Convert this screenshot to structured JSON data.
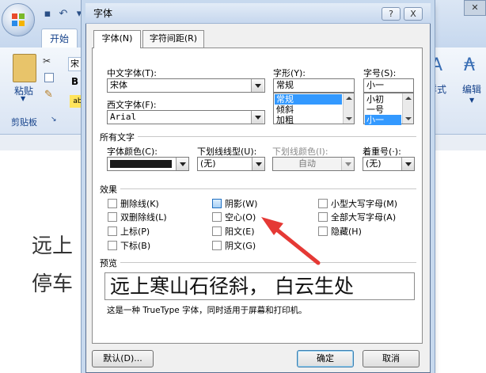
{
  "background": {
    "tab_start": "开始",
    "paste_label": "粘贴",
    "clipboard_label": "剪贴板",
    "font_box_value": "宋",
    "bold_glyph": "B",
    "ab_glyph": "ab",
    "styles_label": "样式",
    "editing_label": "编辑",
    "doc_line1": "远上",
    "doc_line2": "停车"
  },
  "dialog": {
    "title": "字体",
    "help_glyph": "?",
    "close_glyph": "X",
    "tabs": [
      {
        "label": "字体(N)",
        "active": true
      },
      {
        "label": "字符间距(R)",
        "active": false
      }
    ],
    "chinese_font": {
      "label": "中文字体(T):",
      "value": "宋体"
    },
    "western_font": {
      "label": "西文字体(F):",
      "value": "Arial"
    },
    "style": {
      "label": "字形(Y):",
      "value": "常规",
      "options": [
        "常规",
        "倾斜",
        "加粗"
      ],
      "selected": "常规"
    },
    "size": {
      "label": "字号(S):",
      "value": "小一",
      "options": [
        "小初",
        "一号",
        "小一"
      ],
      "selected": "小一"
    },
    "all_text": {
      "heading": "所有文字",
      "font_color": {
        "label": "字体颜色(C):",
        "value_color": "#1a1a1a"
      },
      "underline_type": {
        "label": "下划线线型(U):",
        "value": "(无)"
      },
      "underline_color": {
        "label": "下划线颜色(I):",
        "value": "自动"
      },
      "emphasis": {
        "label": "着重号(·):",
        "value": "(无)"
      }
    },
    "effects": {
      "heading": "效果",
      "col1": [
        "删除线(K)",
        "双删除线(L)",
        "上标(P)",
        "下标(B)"
      ],
      "col2": [
        "阴影(W)",
        "空心(O)",
        "阳文(E)",
        "阴文(G)"
      ],
      "col3": [
        "小型大写字母(M)",
        "全部大写字母(A)",
        "隐藏(H)"
      ],
      "checked": []
    },
    "preview": {
      "heading": "预览",
      "sample": "远上寒山石径斜， 白云生处",
      "note": "这是一种 TrueType 字体，同时适用于屏幕和打印机。"
    },
    "buttons": {
      "default": "默认(D)...",
      "ok": "确定",
      "cancel": "取消"
    }
  },
  "colors": {
    "annotation_arrow": "#e53935",
    "selection": "#3399ff"
  }
}
